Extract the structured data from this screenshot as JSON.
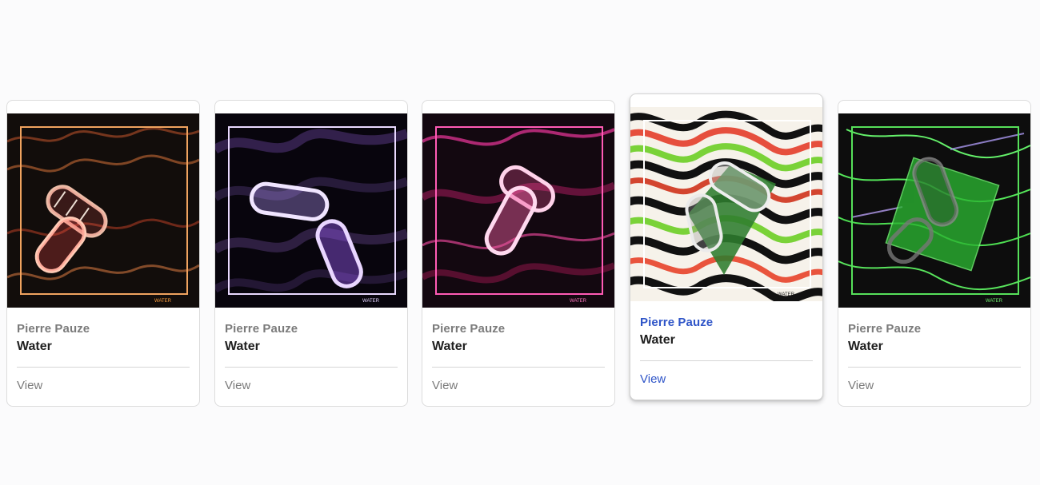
{
  "cards": [
    {
      "artist": "Pierre Pauze",
      "title": "Water",
      "action": "View",
      "theme": "orange",
      "accent": "#e7894a",
      "frame": "#f0a35f",
      "hovered": false
    },
    {
      "artist": "Pierre Pauze",
      "title": "Water",
      "action": "View",
      "theme": "purple",
      "accent": "#9b68e8",
      "frame": "#e9d9ff",
      "hovered": false
    },
    {
      "artist": "Pierre Pauze",
      "title": "Water",
      "action": "View",
      "theme": "magenta",
      "accent": "#e04a98",
      "frame": "#ff5bb5",
      "hovered": false
    },
    {
      "artist": "Pierre Pauze",
      "title": "Water",
      "action": "View",
      "theme": "psychedelic",
      "accent": "#7ad238",
      "frame": "#ffffff",
      "hovered": true
    },
    {
      "artist": "Pierre Pauze",
      "title": "Water",
      "action": "View",
      "theme": "green",
      "accent": "#36c83a",
      "frame": "#56e05a",
      "hovered": false
    }
  ],
  "artwork_watermark": "WATER",
  "colors": {
    "link_active": "#2f55c8",
    "muted_text": "#7b7b7b",
    "title_text": "#1f1f1f"
  }
}
